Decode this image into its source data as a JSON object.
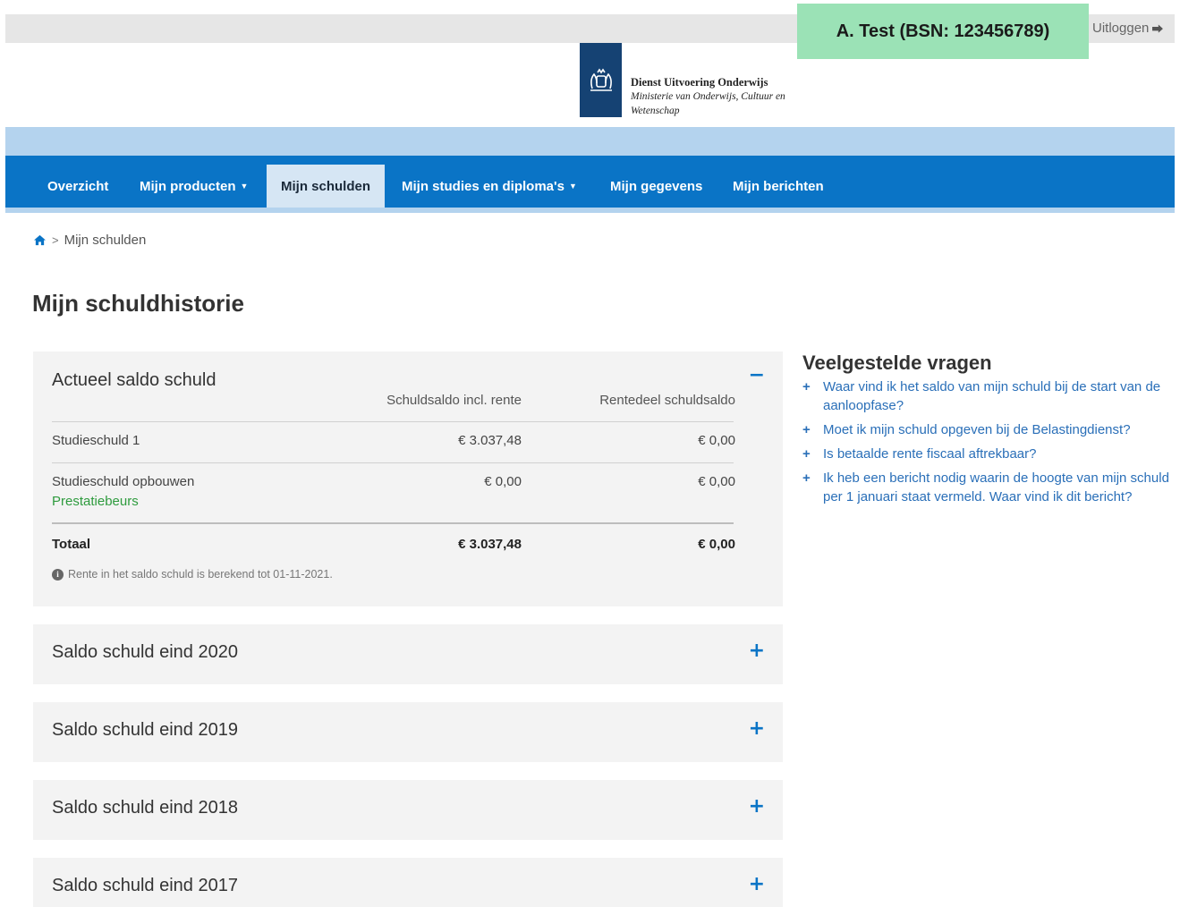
{
  "header": {
    "user_label": "A. Test (BSN: 123456789)",
    "logout_label": "Uitloggen",
    "logo_line1": "Dienst Uitvoering Onderwijs",
    "logo_line2": "Ministerie van Onderwijs, Cultuur en",
    "logo_line3": "Wetenschap"
  },
  "nav": {
    "items": [
      {
        "label": "Overzicht"
      },
      {
        "label": "Mijn producten"
      },
      {
        "label": "Mijn schulden"
      },
      {
        "label": "Mijn studies en diploma's"
      },
      {
        "label": "Mijn gegevens"
      },
      {
        "label": "Mijn berichten"
      }
    ],
    "dropdown_caret": "▼"
  },
  "breadcrumb": {
    "separator": ">",
    "current": "Mijn schulden"
  },
  "page_title": "Mijn schuldhistorie",
  "current_balance": {
    "title": "Actueel saldo schuld",
    "toggle": "−",
    "columns": [
      "Schuldsaldo incl. rente",
      "Rentedeel schuldsaldo"
    ],
    "rows": [
      {
        "label": "Studieschuld 1",
        "sublabel": "",
        "balance": "€ 3.037,48",
        "interest": "€ 0,00"
      },
      {
        "label": "Studieschuld opbouwen",
        "sublabel": "Prestatiebeurs",
        "balance": "€ 0,00",
        "interest": "€ 0,00"
      }
    ],
    "total": {
      "label": "Totaal",
      "balance": "€ 3.037,48",
      "interest": "€ 0,00"
    },
    "note": "Rente in het saldo schuld is berekend tot 01-11-2021."
  },
  "history": [
    {
      "title": "Saldo schuld eind 2020",
      "toggle": "+"
    },
    {
      "title": "Saldo schuld eind 2019",
      "toggle": "+"
    },
    {
      "title": "Saldo schuld eind 2018",
      "toggle": "+"
    },
    {
      "title": "Saldo schuld eind 2017",
      "toggle": "+"
    }
  ],
  "faq": {
    "title": "Veelgestelde vragen",
    "items": [
      {
        "icon": "+",
        "text": "Waar vind ik het saldo van mijn schuld bij de start van de aanloopfase?"
      },
      {
        "icon": "+",
        "text": "Moet ik mijn schuld opgeven bij de Belastingdienst?"
      },
      {
        "icon": "+",
        "text": "Is betaalde rente fiscaal aftrekbaar?"
      },
      {
        "icon": "+",
        "text": "Ik heb een bericht nodig waarin de hoogte van mijn schuld per 1 januari staat vermeld. Waar vind ik dit bericht?"
      }
    ]
  },
  "colors": {
    "nav_blue": "#0a74c6",
    "band_blue": "#b4d3ee",
    "user_green": "#9be2b6",
    "link_blue": "#2a6fb8",
    "green_text": "#2e9b3e"
  }
}
